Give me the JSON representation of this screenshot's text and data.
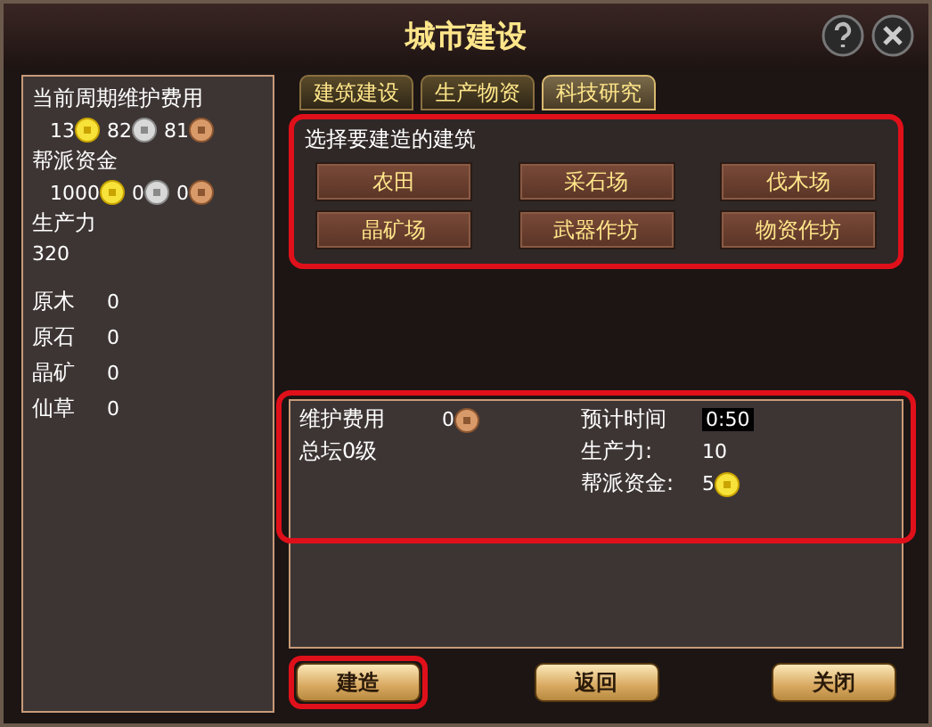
{
  "window": {
    "title": "城市建设"
  },
  "left_panel": {
    "maintenance_label": "当前周期维护费用",
    "maintenance": [
      {
        "amount": "13",
        "kind": "gold"
      },
      {
        "amount": "82",
        "kind": "silver"
      },
      {
        "amount": "81",
        "kind": "copper"
      }
    ],
    "funds_label": "帮派资金",
    "funds": [
      {
        "amount": "1000",
        "kind": "gold"
      },
      {
        "amount": "0",
        "kind": "silver"
      },
      {
        "amount": "0",
        "kind": "copper"
      }
    ],
    "productivity_label": "生产力",
    "productivity": "320",
    "resources": [
      {
        "name": "原木",
        "value": "0"
      },
      {
        "name": "原石",
        "value": "0"
      },
      {
        "name": "晶矿",
        "value": "0"
      },
      {
        "name": "仙草",
        "value": "0"
      }
    ]
  },
  "tabs": [
    {
      "label": "建筑建设",
      "selected": false
    },
    {
      "label": "生产物资",
      "selected": false
    },
    {
      "label": "科技研究",
      "selected": true
    }
  ],
  "building_select": {
    "highlighted": true,
    "prompt": "选择要建造的建筑",
    "buildings": [
      "农田",
      "采石场",
      "伐木场",
      "晶矿场",
      "武器作坊",
      "物资作坊"
    ]
  },
  "info": {
    "highlighted": true,
    "maintenance_label": "维护费用",
    "maintenance": {
      "amount": "0",
      "kind": "copper"
    },
    "level": "总坛0级",
    "time_label": "预计时间",
    "time": "0:50",
    "productivity_label": "生产力:",
    "productivity": "10",
    "funds_label": "帮派资金:",
    "funds": {
      "amount": "5",
      "kind": "gold"
    }
  },
  "buttons": [
    {
      "label": "建造",
      "highlighted": true
    },
    {
      "label": "返回",
      "highlighted": false
    },
    {
      "label": "关闭",
      "highlighted": false
    }
  ]
}
